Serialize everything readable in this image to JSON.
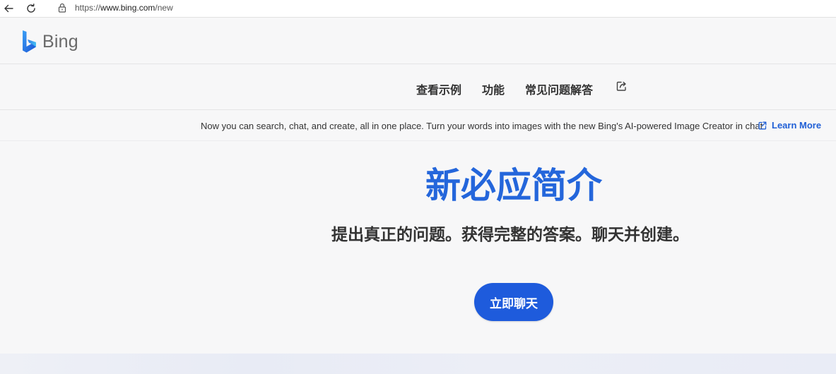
{
  "browser": {
    "url_scheme": "https://",
    "url_host": "www.bing.com",
    "url_path": "/new"
  },
  "logo": {
    "text": "Bing",
    "icon": "bing-logo-icon"
  },
  "nav": {
    "items": [
      {
        "label": "查看示例"
      },
      {
        "label": "功能"
      },
      {
        "label": "常见问题解答"
      }
    ],
    "share_icon": "share-icon"
  },
  "announcement": {
    "text": "Now you can search, chat, and create, all in one place. Turn your words into images with the new Bing's AI-powered Image Creator in chat",
    "link_label": "Learn More",
    "link_icon": "external-link-icon"
  },
  "hero": {
    "title": "新必应简介",
    "subtitle": "提出真正的问题。获得完整的答案。聊天并创建。",
    "cta_label": "立即聊天"
  },
  "colors": {
    "accent": "#2466db",
    "button": "#1e5bdc",
    "link": "#1f5fd6"
  }
}
